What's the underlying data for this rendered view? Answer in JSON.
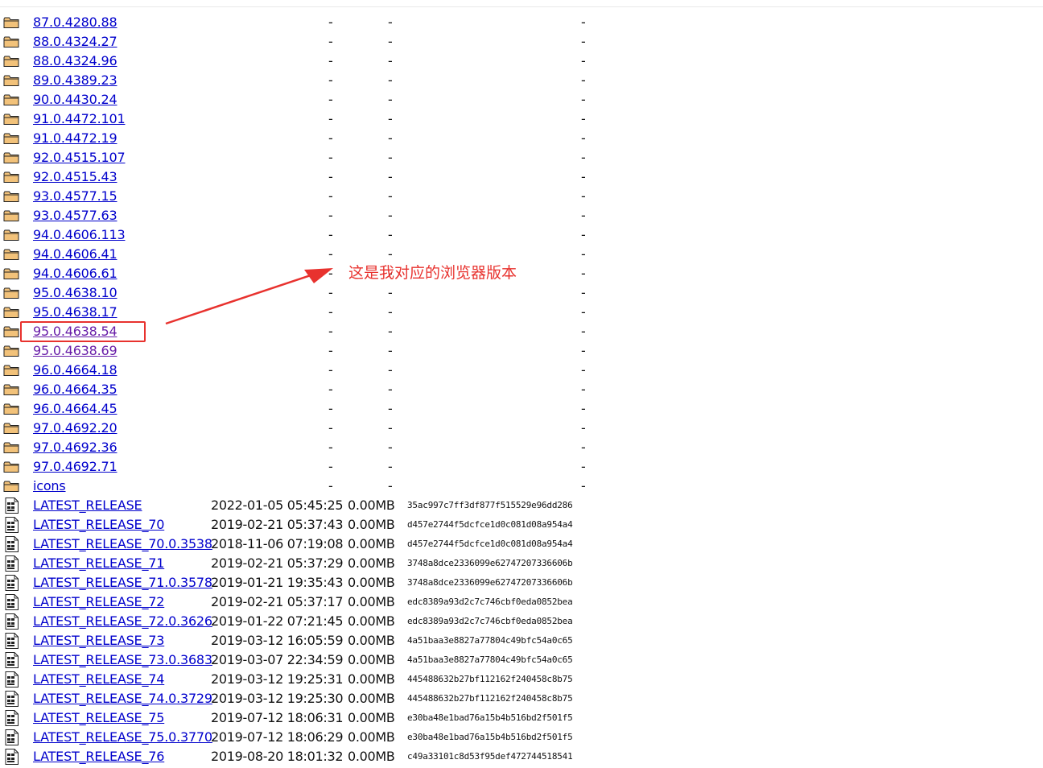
{
  "colors": {
    "link": "#0000cc",
    "visited": "#681da8",
    "annotation": "#e8322e"
  },
  "annotation": {
    "text": "这是我对应的浏览器版本"
  },
  "rows": [
    {
      "name": "87.0.4280.88",
      "type": "folder",
      "date": "-",
      "size": "-",
      "etag": "-"
    },
    {
      "name": "88.0.4324.27",
      "type": "folder",
      "date": "-",
      "size": "-",
      "etag": "-"
    },
    {
      "name": "88.0.4324.96",
      "type": "folder",
      "date": "-",
      "size": "-",
      "etag": "-"
    },
    {
      "name": "89.0.4389.23",
      "type": "folder",
      "date": "-",
      "size": "-",
      "etag": "-"
    },
    {
      "name": "90.0.4430.24",
      "type": "folder",
      "date": "-",
      "size": "-",
      "etag": "-"
    },
    {
      "name": "91.0.4472.101",
      "type": "folder",
      "date": "-",
      "size": "-",
      "etag": "-"
    },
    {
      "name": "91.0.4472.19",
      "type": "folder",
      "date": "-",
      "size": "-",
      "etag": "-"
    },
    {
      "name": "92.0.4515.107",
      "type": "folder",
      "date": "-",
      "size": "-",
      "etag": "-"
    },
    {
      "name": "92.0.4515.43",
      "type": "folder",
      "date": "-",
      "size": "-",
      "etag": "-"
    },
    {
      "name": "93.0.4577.15",
      "type": "folder",
      "date": "-",
      "size": "-",
      "etag": "-"
    },
    {
      "name": "93.0.4577.63",
      "type": "folder",
      "date": "-",
      "size": "-",
      "etag": "-"
    },
    {
      "name": "94.0.4606.113",
      "type": "folder",
      "date": "-",
      "size": "-",
      "etag": "-"
    },
    {
      "name": "94.0.4606.41",
      "type": "folder",
      "date": "-",
      "size": "-",
      "etag": "-"
    },
    {
      "name": "94.0.4606.61",
      "type": "folder",
      "date": "-",
      "size": "-",
      "etag": "-"
    },
    {
      "name": "95.0.4638.10",
      "type": "folder",
      "date": "-",
      "size": "-",
      "etag": "-"
    },
    {
      "name": "95.0.4638.17",
      "type": "folder",
      "date": "-",
      "size": "-",
      "etag": "-"
    },
    {
      "name": "95.0.4638.54",
      "type": "folder",
      "date": "-",
      "size": "-",
      "etag": "-",
      "visited": true
    },
    {
      "name": "95.0.4638.69",
      "type": "folder",
      "date": "-",
      "size": "-",
      "etag": "-",
      "visited": true
    },
    {
      "name": "96.0.4664.18",
      "type": "folder",
      "date": "-",
      "size": "-",
      "etag": "-"
    },
    {
      "name": "96.0.4664.35",
      "type": "folder",
      "date": "-",
      "size": "-",
      "etag": "-"
    },
    {
      "name": "96.0.4664.45",
      "type": "folder",
      "date": "-",
      "size": "-",
      "etag": "-"
    },
    {
      "name": "97.0.4692.20",
      "type": "folder",
      "date": "-",
      "size": "-",
      "etag": "-"
    },
    {
      "name": "97.0.4692.36",
      "type": "folder",
      "date": "-",
      "size": "-",
      "etag": "-"
    },
    {
      "name": "97.0.4692.71",
      "type": "folder",
      "date": "-",
      "size": "-",
      "etag": "-"
    },
    {
      "name": "icons",
      "type": "folder",
      "date": "-",
      "size": "-",
      "etag": "-"
    },
    {
      "name": "LATEST_RELEASE",
      "type": "file",
      "date": "2022-01-05 05:45:25",
      "size": "0.00MB",
      "etag": "35ac997c7ff3df877f515529e96dd286"
    },
    {
      "name": "LATEST_RELEASE_70",
      "type": "file",
      "date": "2019-02-21 05:37:43",
      "size": "0.00MB",
      "etag": "d457e2744f5dcfce1d0c081d08a954a4"
    },
    {
      "name": "LATEST_RELEASE_70.0.3538",
      "type": "file",
      "date": "2018-11-06 07:19:08",
      "size": "0.00MB",
      "etag": "d457e2744f5dcfce1d0c081d08a954a4"
    },
    {
      "name": "LATEST_RELEASE_71",
      "type": "file",
      "date": "2019-02-21 05:37:29",
      "size": "0.00MB",
      "etag": "3748a8dce2336099e62747207336606b"
    },
    {
      "name": "LATEST_RELEASE_71.0.3578",
      "type": "file",
      "date": "2019-01-21 19:35:43",
      "size": "0.00MB",
      "etag": "3748a8dce2336099e62747207336606b"
    },
    {
      "name": "LATEST_RELEASE_72",
      "type": "file",
      "date": "2019-02-21 05:37:17",
      "size": "0.00MB",
      "etag": "edc8389a93d2c7c746cbf0eda0852bea"
    },
    {
      "name": "LATEST_RELEASE_72.0.3626",
      "type": "file",
      "date": "2019-01-22 07:21:45",
      "size": "0.00MB",
      "etag": "edc8389a93d2c7c746cbf0eda0852bea"
    },
    {
      "name": "LATEST_RELEASE_73",
      "type": "file",
      "date": "2019-03-12 16:05:59",
      "size": "0.00MB",
      "etag": "4a51baa3e8827a77804c49bfc54a0c65"
    },
    {
      "name": "LATEST_RELEASE_73.0.3683",
      "type": "file",
      "date": "2019-03-07 22:34:59",
      "size": "0.00MB",
      "etag": "4a51baa3e8827a77804c49bfc54a0c65"
    },
    {
      "name": "LATEST_RELEASE_74",
      "type": "file",
      "date": "2019-03-12 19:25:31",
      "size": "0.00MB",
      "etag": "445488632b27bf112162f240458c8b75"
    },
    {
      "name": "LATEST_RELEASE_74.0.3729",
      "type": "file",
      "date": "2019-03-12 19:25:30",
      "size": "0.00MB",
      "etag": "445488632b27bf112162f240458c8b75"
    },
    {
      "name": "LATEST_RELEASE_75",
      "type": "file",
      "date": "2019-07-12 18:06:31",
      "size": "0.00MB",
      "etag": "e30ba48e1bad76a15b4b516bd2f501f5"
    },
    {
      "name": "LATEST_RELEASE_75.0.3770",
      "type": "file",
      "date": "2019-07-12 18:06:29",
      "size": "0.00MB",
      "etag": "e30ba48e1bad76a15b4b516bd2f501f5"
    },
    {
      "name": "LATEST_RELEASE_76",
      "type": "file",
      "date": "2019-08-20 18:01:32",
      "size": "0.00MB",
      "etag": "c49a33101c8d53f95def472744518541"
    }
  ]
}
